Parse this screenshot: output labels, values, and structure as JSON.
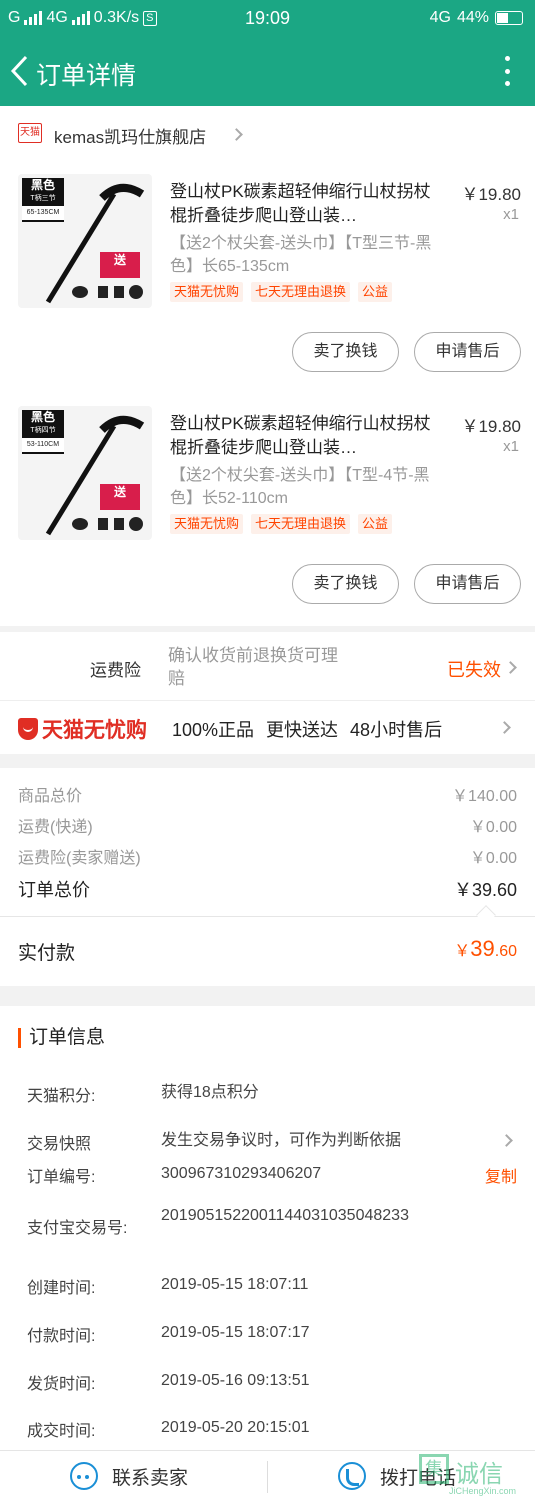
{
  "status_bar": {
    "carrier": "G",
    "net": "4G",
    "speed": "0.3K/s",
    "s_badge": "S",
    "time": "19:09",
    "net_right": "4G",
    "battery": "44%"
  },
  "nav": {
    "title": "订单详情",
    "back_icon": "chevron-left-icon",
    "more_icon": "more-vertical-icon"
  },
  "shop": {
    "badge": "天猫",
    "name": "kemas凯玛仕旗舰店"
  },
  "items": [
    {
      "thumb_tag": "黑色",
      "thumb_spec": "T柄三节",
      "thumb_range": "65-135CM",
      "thumb_gift": "送",
      "title": "登山杖PK碳素超轻伸缩行山杖拐杖棍折叠徒步爬山登山装…",
      "price": "￥19.80",
      "qty": "x1",
      "sku": "【送2个杖尖套-送头巾】【T型三节-黑色】长65-135cm",
      "services": [
        "天猫无忧购",
        "七天无理由退换",
        "公益"
      ],
      "btn_sell": "卖了换钱",
      "btn_after": "申请售后"
    },
    {
      "thumb_tag": "黑色",
      "thumb_spec": "T柄四节",
      "thumb_range": "53-110CM",
      "thumb_gift": "送",
      "title": "登山杖PK碳素超轻伸缩行山杖拐杖棍折叠徒步爬山登山装…",
      "price": "￥19.80",
      "qty": "x1",
      "sku": "【送2个杖尖套-送头巾】【T型-4节-黑色】长52-110cm",
      "services": [
        "天猫无忧购",
        "七天无理由退换",
        "公益"
      ],
      "btn_sell": "卖了换钱",
      "btn_after": "申请售后"
    }
  ],
  "freight_insurance": {
    "label": "运费险",
    "desc": "确认收货前退换货可理赔",
    "status": "已失效"
  },
  "worry_free": {
    "logo": "天猫无忧购",
    "features": [
      "100%正品",
      "更快送达",
      "48小时售后"
    ]
  },
  "summary": {
    "rows": [
      {
        "label": "商品总价",
        "value": "￥140.00"
      },
      {
        "label": "运费(快递)",
        "value": "￥0.00"
      },
      {
        "label": "运费险(卖家赠送)",
        "value": "￥0.00"
      }
    ],
    "order_total_label": "订单总价",
    "order_total": "￥39.60",
    "paid_label": "实付款",
    "paid_currency": "￥",
    "paid_int": "39",
    "paid_dec": ".60"
  },
  "order_info": {
    "heading": "订单信息",
    "rows": [
      {
        "label": "天猫积分:",
        "value": "获得18点积分"
      },
      {
        "label": "交易快照",
        "value": "发生交易争议时，可作为判断依据"
      },
      {
        "label": "订单编号:",
        "value": "300967310293406207",
        "action": "复制"
      },
      {
        "label": "支付宝交易号:",
        "value": "2019051522001144031035048233"
      },
      {
        "label": "创建时间:",
        "value": "2019-05-15 18:07:11"
      },
      {
        "label": "付款时间:",
        "value": "2019-05-15 18:07:17"
      },
      {
        "label": "发货时间:",
        "value": "2019-05-16 09:13:51"
      },
      {
        "label": "成交时间:",
        "value": "2019-05-20 20:15:01"
      }
    ]
  },
  "bottom_bar": {
    "contact_seller": "联系卖家",
    "call": "拨打电话"
  },
  "watermark": {
    "mark": "集",
    "text": "诚信",
    "url": "JiCHengXin.com"
  },
  "colors": {
    "primary": "#1ba784",
    "accent": "#ff5000",
    "tmall_red": "#e02e24",
    "icon_blue": "#1a8fd6"
  }
}
